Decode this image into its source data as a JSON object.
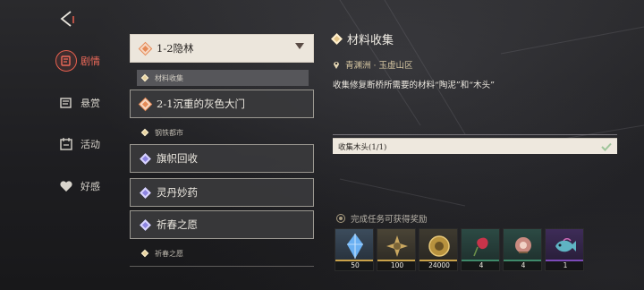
{
  "nav": {
    "items": [
      {
        "label": "剧情",
        "icon": "story-scroll-icon",
        "active": true
      },
      {
        "label": "悬赏",
        "icon": "bounty-icon",
        "active": false
      },
      {
        "label": "活动",
        "icon": "activity-icon",
        "active": false
      },
      {
        "label": "好感",
        "icon": "heart-icon",
        "active": false
      }
    ]
  },
  "quests": {
    "groups": [
      {
        "title": "1-2隐林",
        "selected": true,
        "subs": [
          {
            "label": "材料收集",
            "selected": true
          }
        ]
      },
      {
        "title": "2-1沉重的灰色大门",
        "selected": false,
        "subs": []
      }
    ],
    "category_1": "钢铁都市",
    "others": [
      "旗帜回收",
      "灵丹妙药",
      "祈春之愿"
    ],
    "category_2": "祈春之愿"
  },
  "detail": {
    "title": "材料收集",
    "location": "青渊洲 · 玉虚山区",
    "description": "收集修复断桥所需要的材料“陶泥”和“木头”",
    "objective": "收集木头(1/1)",
    "reward_header": "完成任务可获得奖励"
  },
  "rewards": [
    {
      "count": "50",
      "icon": "blue-crystal-icon",
      "rarity_color": "#c9a24a"
    },
    {
      "count": "100",
      "icon": "gold-spike-icon",
      "rarity_color": "#c9a24a"
    },
    {
      "count": "24000",
      "icon": "gold-coin-icon",
      "rarity_color": "#c9a24a"
    },
    {
      "count": "4",
      "icon": "red-flower-icon",
      "rarity_color": "#3f8a6a"
    },
    {
      "count": "4",
      "icon": "rose-bundle-icon",
      "rarity_color": "#3f8a6a"
    },
    {
      "count": "1",
      "icon": "purple-fish-icon",
      "rarity_color": "#7c4ab8"
    }
  ]
}
